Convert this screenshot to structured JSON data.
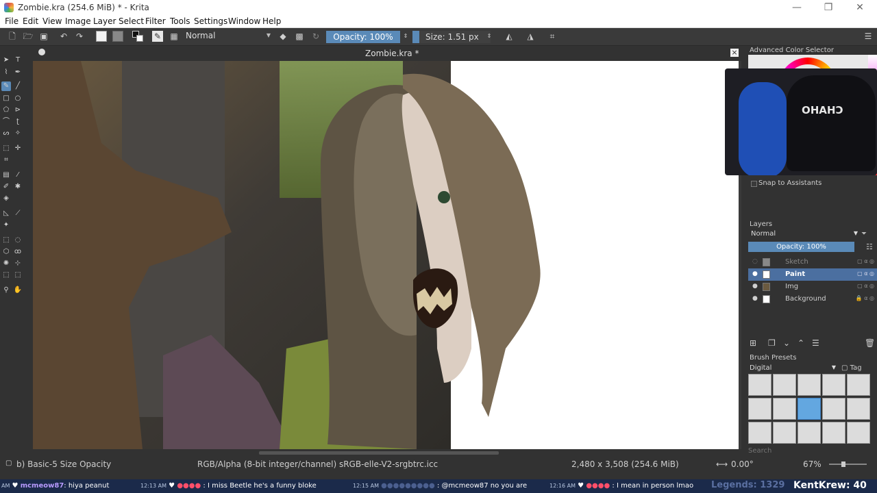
{
  "window": {
    "title": "Zombie.kra (254.6 MiB)  * - Krita"
  },
  "menu": [
    "File",
    "Edit",
    "View",
    "Image",
    "Layer",
    "Select",
    "Filter",
    "Tools",
    "Settings",
    "Window",
    "Help"
  ],
  "toolbar": {
    "blend_mode": "Normal",
    "opacity_label": "Opacity: 100%",
    "opacity_value": 1.0,
    "size_label": "Size: 1.51 px"
  },
  "canvas": {
    "tab_title": "Zombie.kra *",
    "close_glyph": "×"
  },
  "right_panel": {
    "color_selector_title": "Advanced Color Selector",
    "webcam_chair_text": "CHAHO",
    "snap_label": "Snap to Assistants",
    "layers_title": "Layers",
    "layers_blend": "Normal",
    "layers_opacity": "Opacity:  100%",
    "layers": [
      {
        "name": "Sketch",
        "visible": false,
        "active": false
      },
      {
        "name": "Paint",
        "visible": true,
        "active": true
      },
      {
        "name": "Img",
        "visible": true,
        "active": false
      },
      {
        "name": "Background",
        "visible": true,
        "active": false,
        "locked": true
      }
    ],
    "brush_presets_title": "Brush Presets",
    "brush_tag_select": "Digital",
    "brush_tag_label": "Tag",
    "search_placeholder": "Search"
  },
  "status": {
    "brush_name": "b) Basic-5 Size Opacity",
    "color_space": "RGB/Alpha (8-bit integer/channel)  sRGB-elle-V2-srgbtrc.icc",
    "image_size": "2,480 x 3,508 (254.6 MiB)",
    "rotation": "0.00°",
    "zoom": "67%"
  },
  "stream": {
    "chat": [
      {
        "time": "AM",
        "user": "mcmeow87",
        "text": ": hiya peanut"
      },
      {
        "time": "12:13 AM",
        "user": "",
        "text": "I miss Beetle he's a funny bloke"
      },
      {
        "time": "12:15 AM",
        "user": "",
        "text": "@mcmeow87 no you are"
      },
      {
        "time": "12:16 AM",
        "user": "",
        "text": "I mean in person lmao"
      }
    ],
    "legends": "Legends: 1329",
    "channel": "KentKrew: 40"
  },
  "colors": {
    "accent": "#5a8ab8",
    "panel_bg": "#323232",
    "stream_bg": "#1b2a4a"
  }
}
